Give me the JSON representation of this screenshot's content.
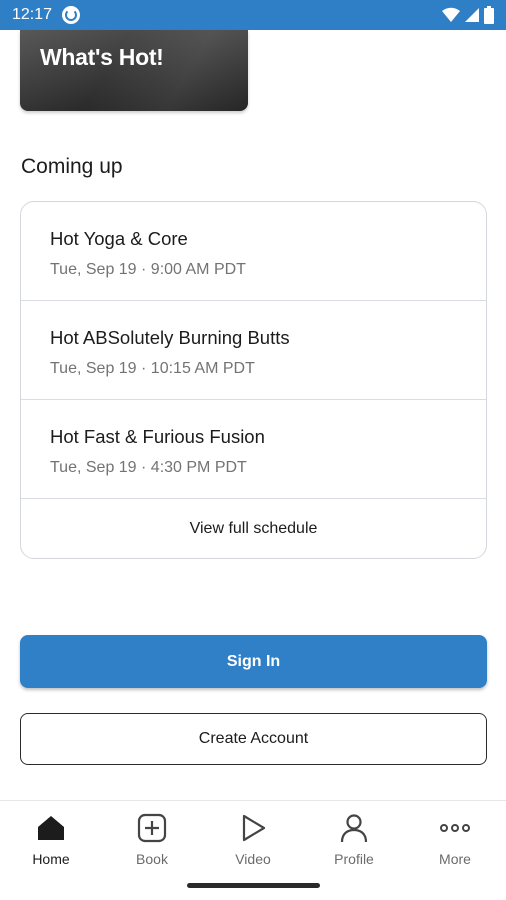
{
  "status_bar": {
    "time": "12:17",
    "background": "#2f7fc6"
  },
  "hero": {
    "title": "What's Hot!"
  },
  "coming_up": {
    "title": "Coming up",
    "classes": [
      {
        "name": "Hot Yoga & Core",
        "time": "Tue, Sep 19 · 9:00 AM PDT"
      },
      {
        "name": "Hot ABSolutely Burning Butts",
        "time": "Tue, Sep 19 · 10:15 AM PDT"
      },
      {
        "name": "Hot Fast & Furious Fusion",
        "time": "Tue, Sep 19 · 4:30 PM PDT"
      }
    ],
    "view_full_label": "View full schedule"
  },
  "actions": {
    "sign_in_label": "Sign In",
    "create_account_label": "Create Account",
    "accent": "#2f80c7"
  },
  "bottom_nav": {
    "items": [
      {
        "label": "Home",
        "icon": "home-icon",
        "active": true
      },
      {
        "label": "Book",
        "icon": "book-plus-icon",
        "active": false
      },
      {
        "label": "Video",
        "icon": "play-icon",
        "active": false
      },
      {
        "label": "Profile",
        "icon": "person-icon",
        "active": false
      },
      {
        "label": "More",
        "icon": "more-dots-icon",
        "active": false
      }
    ]
  }
}
